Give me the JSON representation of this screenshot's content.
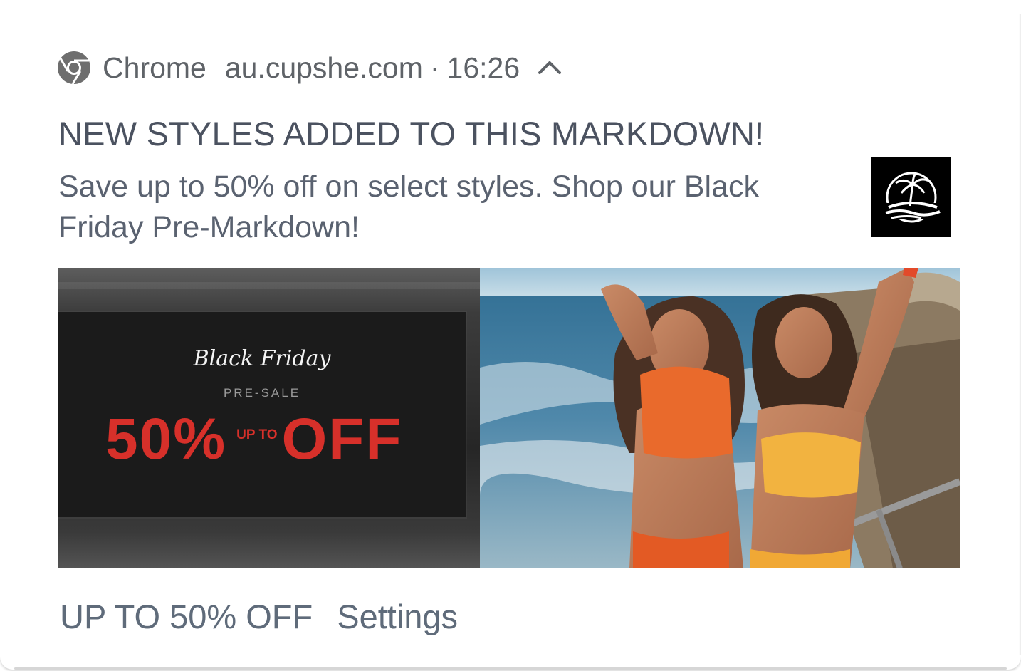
{
  "notification": {
    "app_name": "Chrome",
    "site": "au.cupshe.com",
    "separator": "·",
    "time": "16:26",
    "icons": {
      "app": "chrome-icon",
      "expand": "chevron-up-icon",
      "thumbnail": "palm-island-logo-icon"
    },
    "title": "NEW STYLES ADDED TO THIS MARKDOWN!",
    "body": "Save up to 50% off on select styles. Shop our Black Friday Pre-Markdown!"
  },
  "banner": {
    "script_text": "Black Friday",
    "presale_text": "PRE-SALE",
    "discount": "50%",
    "upto_text": "UP TO",
    "off_text": "OFF",
    "accent_color": "#d7302a"
  },
  "actions": {
    "primary_label": "UP TO 50% OFF",
    "settings_label": "Settings"
  }
}
